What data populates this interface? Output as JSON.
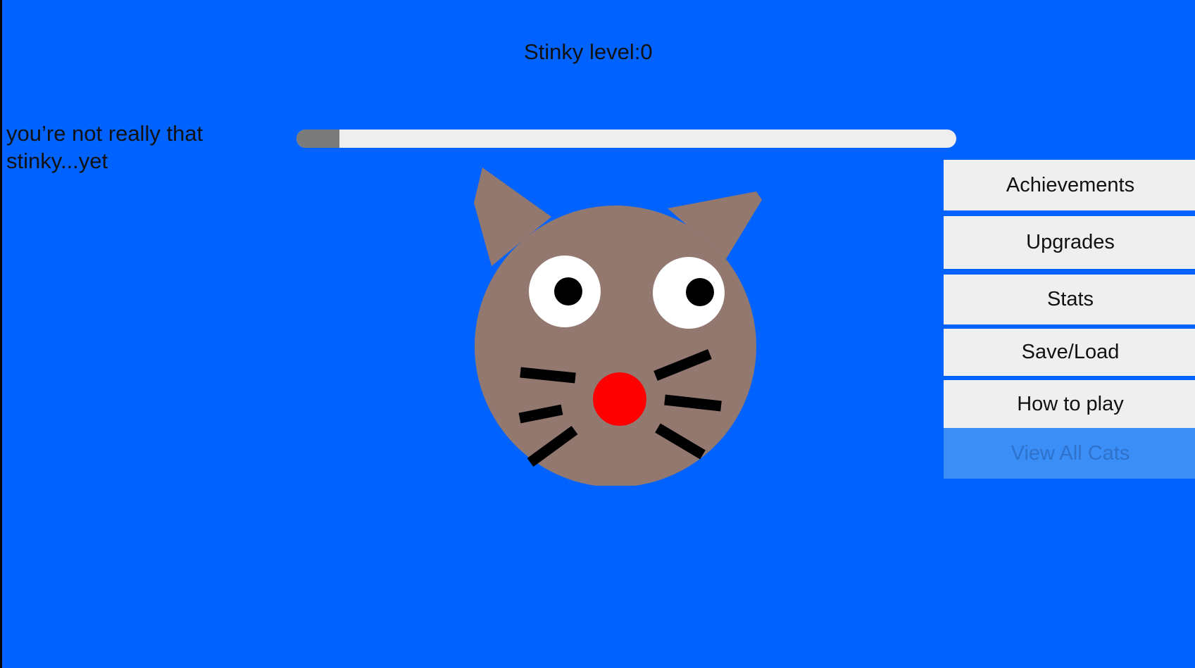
{
  "game": {
    "stinky_label": "Stinky level:0",
    "flavor_text": "you’re  not really that\nstinky...yet",
    "stinky_progress": 0.065
  },
  "menu": {
    "achievements": "Achievements",
    "upgrades": "Upgrades",
    "stats": "Stats",
    "save_load": "Save/Load",
    "how_to_play": "How to play",
    "view_all_cats": "View All Cats"
  },
  "colors": {
    "background": "#0062ff",
    "progress_track": "#eeeeee",
    "progress_fill": "#7b7b7b",
    "cat_fur": "#937870",
    "cat_nose": "#ff0000",
    "button": "#efefef",
    "button_disabled": "#3a8ef6"
  },
  "icons": {
    "cat": "cat-face-icon"
  }
}
